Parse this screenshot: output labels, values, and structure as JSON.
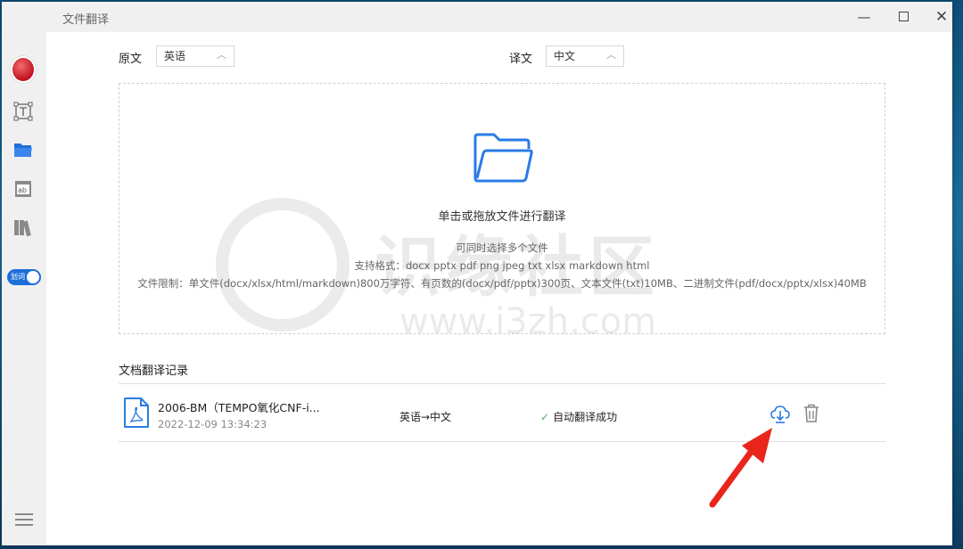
{
  "window": {
    "title": "文件翻译"
  },
  "sidebar": {
    "toggle_label": "划词",
    "avatar_text": "■"
  },
  "lang": {
    "source_label": "原文",
    "source_value": "英语",
    "target_label": "译文",
    "target_value": "中文"
  },
  "dropzone": {
    "main": "单击或拖放文件进行翻译",
    "multi": "可同时选择多个文件",
    "formats": "支持格式：docx pptx pdf png jpeg txt xlsx markdown html",
    "limits": "文件限制：单文件(docx/xlsx/html/markdown)800万字符、有页数的(docx/pdf/pptx)300页、文本文件(txt)10MB、二进制文件(pdf/docx/pptx/xlsx)40MB"
  },
  "watermark": {
    "text": "识缘社区",
    "url": "www.i3zh.com"
  },
  "records": {
    "title": "文档翻译记录",
    "items": [
      {
        "name": "2006-BM（TEMPO氧化CNF-i...",
        "date": "2022-12-09 13:34:23",
        "lang": "英语→中文",
        "status": "自动翻译成功"
      }
    ]
  },
  "colors": {
    "accent": "#1e6fd9",
    "success": "#4caf50",
    "annotation_arrow": "#e8261c"
  }
}
